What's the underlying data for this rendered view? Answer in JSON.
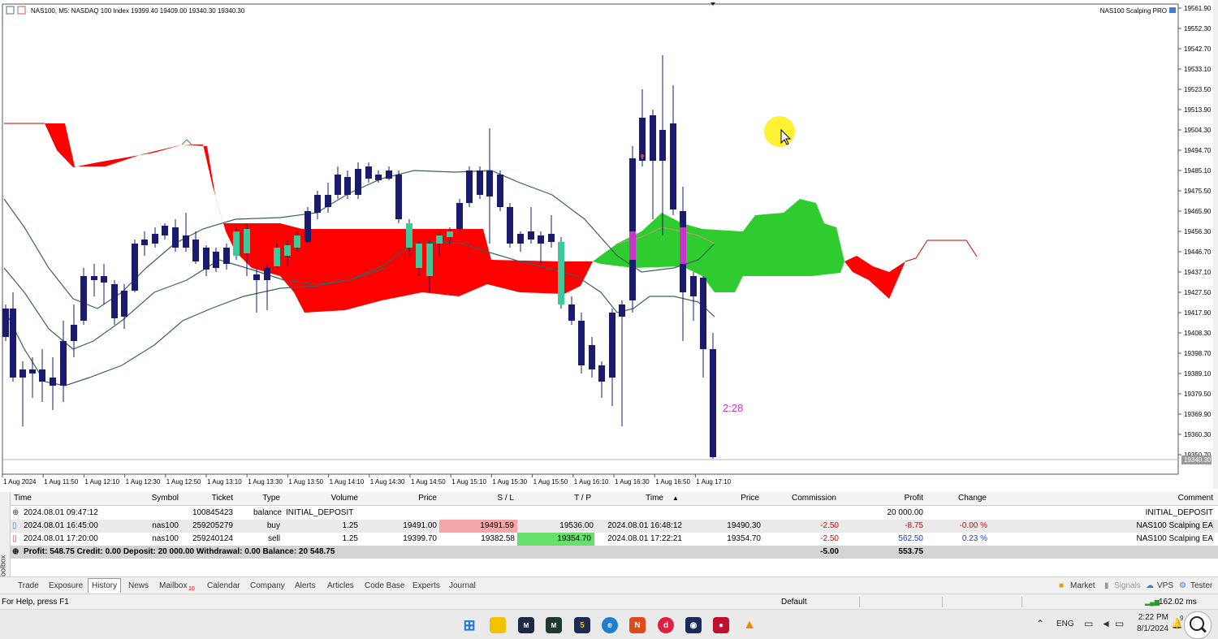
{
  "chart": {
    "header": "NAS100, M5:  NASDAQ 100 Index  19399.40 19409.00 19340.30 19340.30",
    "ea_label": "NAS100 Scalping PRO",
    "countdown": "2:28",
    "colors": {
      "bull": "#3ec99a",
      "bear": "#1a1a6e",
      "kumo_bear": "#ff0000",
      "kumo_bull": "#2ecc2e",
      "baseline": "#3f5f5f",
      "countdown": "#cc33cc",
      "pointer": "#ffee00"
    },
    "price_labels": [
      "19561.90",
      "19552.30",
      "19542.70",
      "19533.10",
      "19523.50",
      "19513.90",
      "19504.30",
      "19494.70",
      "19485.10",
      "19475.50",
      "19465.90",
      "19456.30",
      "19446.70",
      "19437.10",
      "19427.50",
      "19417.90",
      "19408.30",
      "19398.70",
      "19389.10",
      "19379.50",
      "19369.90",
      "19360.30",
      "19350.70"
    ],
    "current_price": "19340.30",
    "time_labels": [
      "1 Aug 2024",
      "1 Aug 11:50",
      "1 Aug 12:10",
      "1 Aug 12:30",
      "1 Aug 12:50",
      "1 Aug 13:10",
      "1 Aug 13:30",
      "1 Aug 13:50",
      "1 Aug 14:10",
      "1 Aug 14:30",
      "1 Aug 14:50",
      "1 Aug 15:10",
      "1 Aug 15:30",
      "1 Aug 15:50",
      "1 Aug 16:10",
      "1 Aug 16:30",
      "1 Aug 16:50",
      "1 Aug 17:10"
    ]
  },
  "history": {
    "columns": {
      "time": "Time",
      "symbol": "Symbol",
      "ticket": "Ticket",
      "type": "Type",
      "volume": "Volume",
      "price": "Price",
      "sl": "S / L",
      "tp": "T / P",
      "time2": "Time",
      "sort_arrow": "▲",
      "price2": "Price",
      "commission": "Commission",
      "profit": "Profit",
      "change": "Change",
      "comment": "Comment"
    },
    "rows": [
      {
        "time": "2024.08.01 09:47:12",
        "symbol": "",
        "ticket": "100845423",
        "type": "balance",
        "volume": "INITIAL_DEPOSIT",
        "price": "",
        "sl": "",
        "tp": "",
        "time2": "",
        "price2": "",
        "commission": "",
        "profit": "20 000.00",
        "change": "",
        "comment": "INITIAL_DEPOSIT"
      },
      {
        "time": "2024.08.01 16:45:00",
        "symbol": "nas100",
        "ticket": "259205279",
        "type": "buy",
        "volume": "1.25",
        "price": "19491.00",
        "sl": "19491.59",
        "tp": "19536.00",
        "time2": "2024.08.01 16:48:12",
        "price2": "19490.30",
        "commission": "-2.50",
        "profit": "-8.75",
        "change": "-0.00 %",
        "comment": "NAS100 Scalping EA"
      },
      {
        "time": "2024.08.01 17:20:00",
        "symbol": "nas100",
        "ticket": "259240124",
        "type": "sell",
        "volume": "1.25",
        "price": "19399.70",
        "sl": "19382.58",
        "tp": "19354.70",
        "time2": "2024.08.01 17:22:21",
        "price2": "19354.70",
        "commission": "-2.50",
        "profit": "562.50",
        "change": "0.23 %",
        "comment": "NAS100 Scalping EA"
      }
    ],
    "summary": {
      "text": "Profit: 548.75  Credit: 0.00  Deposit: 20 000.00  Withdrawal: 0.00  Balance: 20 548.75",
      "commission": "-5.00",
      "profit": "553.75"
    }
  },
  "toolbox_label": "Toolbox",
  "tabs": [
    "Trade",
    "Exposure",
    "History",
    "News",
    "Mailbox",
    "Calendar",
    "Company",
    "Alerts",
    "Articles",
    "Code Base",
    "Experts",
    "Journal"
  ],
  "mailbox_badge": "10",
  "right_tabs": [
    "Market",
    "Signals",
    "VPS",
    "Tester"
  ],
  "status": {
    "help": "For Help, press F1",
    "profile": "Default",
    "ping": "162.02 ms"
  },
  "taskbar": {
    "lang": "ENG",
    "time": "2:22 PM",
    "date": "8/1/2024",
    "notif": "9"
  }
}
